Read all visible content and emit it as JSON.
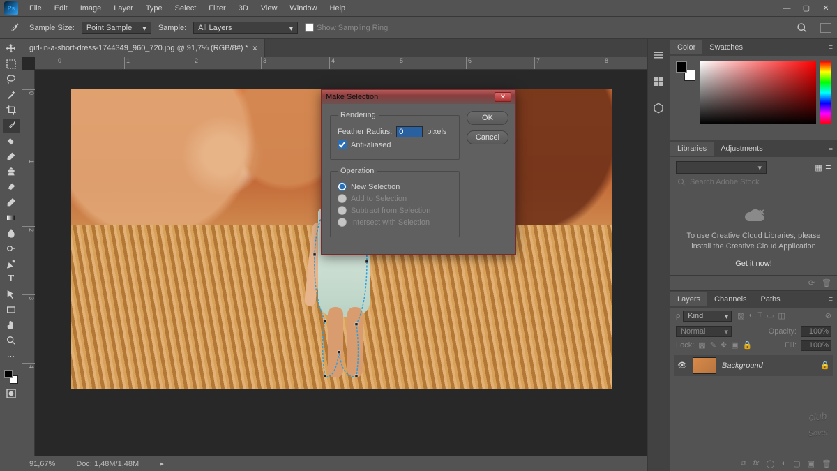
{
  "menu": [
    "File",
    "Edit",
    "Image",
    "Layer",
    "Type",
    "Select",
    "Filter",
    "3D",
    "View",
    "Window",
    "Help"
  ],
  "options": {
    "sample_size_label": "Sample Size:",
    "sample_size_value": "Point Sample",
    "sample_label": "Sample:",
    "sample_value": "All Layers",
    "show_ring": "Show Sampling Ring"
  },
  "doc": {
    "tab": "girl-in-a-short-dress-1744349_960_720.jpg @ 91,7% (RGB/8#) *",
    "zoom": "91,67%",
    "docinfo": "Doc: 1,48M/1,48M"
  },
  "ruler_h": [
    "0",
    "1",
    "2",
    "3",
    "4",
    "5",
    "6",
    "7",
    "8"
  ],
  "ruler_v": [
    "0",
    "1",
    "2",
    "3",
    "4"
  ],
  "dialog": {
    "title": "Make Selection",
    "rendering": "Rendering",
    "feather": "Feather Radius:",
    "feather_val": "0",
    "pixels": "pixels",
    "anti": "Anti-aliased",
    "operation": "Operation",
    "op_new": "New Selection",
    "op_add": "Add to Selection",
    "op_sub": "Subtract from Selection",
    "op_int": "Intersect with Selection",
    "ok": "OK",
    "cancel": "Cancel"
  },
  "panels": {
    "color_tab": "Color",
    "swatches_tab": "Swatches",
    "libraries_tab": "Libraries",
    "adjustments_tab": "Adjustments",
    "search_ph": "Search Adobe Stock",
    "cc_text": "To use Creative Cloud Libraries, please install the Creative Cloud Application",
    "cc_link": "Get it now!",
    "layers_tab": "Layers",
    "channels_tab": "Channels",
    "paths_tab": "Paths",
    "kind": "Kind",
    "blend": "Normal",
    "opacity_lbl": "Opacity:",
    "opacity_val": "100%",
    "lock_lbl": "Lock:",
    "fill_lbl": "Fill:",
    "fill_val": "100%",
    "layer_name": "Background"
  },
  "watermark": {
    "club": "club",
    "name": "Sovet"
  }
}
